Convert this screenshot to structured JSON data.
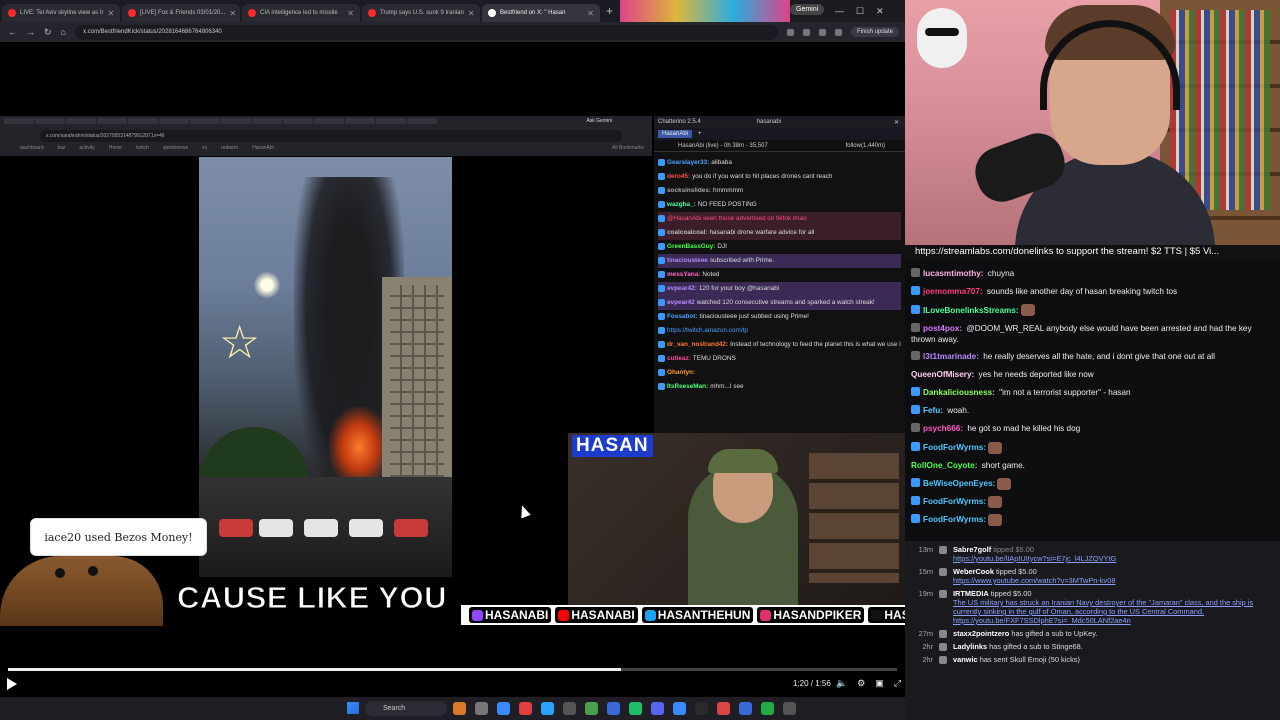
{
  "browser": {
    "tabs": [
      {
        "label": "LIVE: Tel Aviv skyline view as Ir",
        "color": "#ff2a2a",
        "active": false
      },
      {
        "label": "[LIVE] Fox & Friends 03/01/20...",
        "color": "#ff2a2a",
        "active": false
      },
      {
        "label": "CIA intelligence led to missile",
        "color": "#ff2a2a",
        "active": false
      },
      {
        "label": "Trump says U.S. sunk 9 Iranian",
        "color": "#ff2a2a",
        "active": false
      },
      {
        "label": "Bestfriend on X: \" Hasan",
        "color": "#ffffff",
        "active": true
      }
    ],
    "gemini_label": "Gemini",
    "url": "x.com/BestfriendKick/status/2028164686764806340",
    "finish_update": "Finish update"
  },
  "inner": {
    "url": "x.com/sarahrahm/status/2027955314879912871s=46",
    "ask": "Ask Gemini",
    "bookmarks": [
      "dashboard",
      "kaz",
      "activity",
      "Home",
      "twitch",
      "sportsnews",
      "vx",
      "redeem",
      "HasanAbi"
    ],
    "all_bookmarks": "All Bookmarks"
  },
  "video": {
    "caption": "CAUSE LIKE YOU",
    "donation_text": "iace20 used Bezos Money!",
    "time": "1:20 / 1:56",
    "progress": 0.69
  },
  "chatterino": {
    "title": "Chatterino 2.5.4",
    "window_user": "hasanabi",
    "tab": "HasanAbi",
    "status": "HasanAbi (live) - 0h 38m - 35,507",
    "follow": "follow(1,440m)",
    "lines": [
      {
        "user": "Gearslayer33:",
        "color": "#4ea3ff",
        "text": "alibaba",
        "style": ""
      },
      {
        "user": "dero45:",
        "color": "#ff4a4a",
        "text": "you do if you want to hit places drones cant reach",
        "style": ""
      },
      {
        "user": "socksinslides:",
        "color": "#aaa",
        "text": "hmmmmm",
        "style": ""
      },
      {
        "user": "wazgha_:",
        "color": "#4aff9a",
        "text": "NO FEED POSTING",
        "style": ""
      },
      {
        "user": "",
        "color": "#ff4a7a",
        "text": "@HasanAbi seen those advertised on tiktok lmao",
        "style": "hl"
      },
      {
        "user": "coalcoalcoal:",
        "color": "#bbb",
        "text": "hasanabi drone warfare advice for all",
        "style": "hl"
      },
      {
        "user": "GreenBassGuy:",
        "color": "#4aff4a",
        "text": "DJI",
        "style": ""
      },
      {
        "user": "tinaciousteee",
        "color": "#b38aff",
        "text": "subscribed with Prime.",
        "style": "purple"
      },
      {
        "user": "messYana:",
        "color": "#ff66cc",
        "text": "Noted",
        "style": ""
      },
      {
        "user": "evpear42:",
        "color": "#b38aff",
        "text": "120 for your boy @hasanabi",
        "style": "purple"
      },
      {
        "user": "evpear42",
        "color": "#b38aff",
        "text": "watched 120 consecutive streams and sparked a watch streak!",
        "style": "purple"
      },
      {
        "user": "Fossabot:",
        "color": "#4aa0ff",
        "text": "tinaciousteee just subbed using Prime!",
        "style": ""
      },
      {
        "user": "",
        "color": "#4aa0ff",
        "text": "https://twitch.amazon.com/tp",
        "style": ""
      },
      {
        "user": "dr_van_nostrand42:",
        "color": "#ff7a3a",
        "text": "Instead of technology to feed the planet this is what we use it on",
        "style": ""
      },
      {
        "user": "cutieaz:",
        "color": "#ff4a9a",
        "text": "TEMU DRONS",
        "style": ""
      },
      {
        "user": "Ohantyn:",
        "color": "#ff9a3a",
        "text": "",
        "style": ""
      },
      {
        "user": "ItsReeseMan:",
        "color": "#4aff7a",
        "text": "mhm...I see",
        "style": ""
      }
    ]
  },
  "overlay": {
    "logo": "HASAN",
    "handles": [
      {
        "text": "HASANABI",
        "color": "#9146ff"
      },
      {
        "text": "HASANABI",
        "color": "#ff0000"
      },
      {
        "text": "HASANTHEHUN",
        "color": "#1da1f2"
      },
      {
        "text": "HASANDPIKER",
        "color": "#e1306c"
      },
      {
        "text": "HASANDPIKER",
        "color": "#111111"
      }
    ]
  },
  "taskbar": {
    "search": "Search",
    "icons": [
      "#d97a2a",
      "#777",
      "#3a8bff",
      "#e04040",
      "#2aa0ff",
      "#555",
      "#4aa04a",
      "#3a6ad8",
      "#1dbf6a",
      "#5865f2",
      "#3a8bff",
      "#2a2a2a",
      "#d44",
      "#3a6ad8",
      "#22aa44",
      "#555"
    ]
  },
  "rchat": {
    "promo": "https://streamlabs.com/donelinks to support the stream! $2 TTS | $5 Vi...",
    "lines": [
      {
        "user": "lucasmtimothy:",
        "color": "#ffb0e0",
        "text": "chuyna",
        "badge": "#666"
      },
      {
        "user": "joemomma707:",
        "color": "#ff3a7a",
        "text": "sounds like another day of hasan breaking twitch tos",
        "badge": "#3a9aff"
      },
      {
        "user": "ILoveBonelinksStreams:",
        "color": "#4aff9a",
        "text": "",
        "badge": "#3a9aff",
        "emote": true
      },
      {
        "user": "post4pox:",
        "color": "#d47aff",
        "text": "@DOOM_WR_REAL anybody else would have been arrested and had the key thrown away.",
        "badge": "#666"
      },
      {
        "user": "l3t1tmarinade:",
        "color": "#b38aff",
        "text": "he really deserves all the hate, and i dont give that one out at all",
        "badge": "#666"
      },
      {
        "user": "QueenOfMisery:",
        "color": "#ffd0f0",
        "text": "yes he needs deported like now",
        "badge": ""
      },
      {
        "user": "Dankaliciousness:",
        "color": "#8aff5a",
        "text": "\"im not a terrorist supporter\" - hasan",
        "badge": "#3a9aff"
      },
      {
        "user": "Fefu:",
        "color": "#5ac8ff",
        "text": "woah.",
        "badge": "#3a9aff"
      },
      {
        "user": "psych666:",
        "color": "#ff5ac8",
        "text": "he got so mad he killed his dog",
        "badge": "#666"
      },
      {
        "user": "FoodForWyrms:",
        "color": "#4ac8ff",
        "text": "",
        "badge": "#3a9aff",
        "emote": true
      },
      {
        "user": "RollOne_Coyote:",
        "color": "#4aff4a",
        "text": "short game.",
        "badge": ""
      },
      {
        "user": "BeWiseOpenEyes:",
        "color": "#4ac8ff",
        "text": "",
        "badge": "#3a9aff",
        "emote": true
      },
      {
        "user": "FoodForWyrms:",
        "color": "#4ac8ff",
        "text": "",
        "badge": "#3a9aff",
        "emote": true
      },
      {
        "user": "FoodForWyrms:",
        "color": "#4ac8ff",
        "text": "",
        "badge": "#3a9aff",
        "emote": true
      }
    ],
    "events": [
      {
        "time": "13m",
        "name": "Sabre7golf",
        "action": "tipped $5.00",
        "detail": "https://youtu.be/lIApIUItycw?si=E7jc_l4LJZQVYtG",
        "faded": true
      },
      {
        "time": "15m",
        "name": "WeberCook",
        "action": "tipped $5.00",
        "detail": "https://www.youtube.com/watch?v=3MTwPn-kv08",
        "faded": false
      },
      {
        "time": "19m",
        "name": "IRTMEDIA",
        "action": "tipped $5.00",
        "detail": "The US military has struck an Iranian Navy destroyer of the \"Jamaran\" class, and the ship is currently sinking in the gulf of Oman, according to the US Central Command. https://youtu.be/FXF7SSDlphE?si=_Mdc50LANf2ae4n",
        "faded": false
      },
      {
        "time": "27m",
        "name": "staxx2pointzero",
        "action": "has gifted a sub to UpKey.",
        "detail": "",
        "faded": false
      },
      {
        "time": "2hr",
        "name": "Ladylinks",
        "action": "has gifted a sub to Stinge68.",
        "detail": "",
        "faded": false
      },
      {
        "time": "2hr",
        "name": "vanwic",
        "action": "has sent Skull Emoji (50 kicks)",
        "detail": "",
        "faded": false
      }
    ]
  }
}
